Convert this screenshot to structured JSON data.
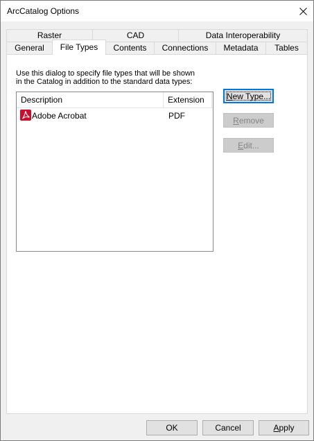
{
  "window": {
    "title": "ArcCatalog Options"
  },
  "tabs": {
    "row_back": [
      {
        "label": "Raster"
      },
      {
        "label": "CAD"
      },
      {
        "label": "Data Interoperability"
      }
    ],
    "row_front": [
      {
        "label": "General"
      },
      {
        "label": "File Types"
      },
      {
        "label": "Contents"
      },
      {
        "label": "Connections"
      },
      {
        "label": "Metadata"
      },
      {
        "label": "Tables"
      }
    ],
    "selected": "File Types"
  },
  "file_types": {
    "instructions_line1": "Use this dialog to specify file types that will be shown",
    "instructions_line2": "in the Catalog in addition to the standard data types:",
    "columns": {
      "description": "Description",
      "extension": "Extension"
    },
    "rows": [
      {
        "description": "Adobe Acrobat",
        "extension": "PDF",
        "icon": "pdf-icon"
      }
    ],
    "buttons": {
      "new_type": {
        "accel": "N",
        "rest": "ew Type..."
      },
      "remove": {
        "accel": "R",
        "rest": "emove"
      },
      "edit": {
        "accel": "E",
        "rest": "dit..."
      }
    }
  },
  "footer": {
    "ok": "OK",
    "cancel": "Cancel",
    "apply_accel": "A",
    "apply_rest": "pply"
  },
  "colors": {
    "accent": "#0078d7",
    "pdf_red": "#c8102e"
  }
}
